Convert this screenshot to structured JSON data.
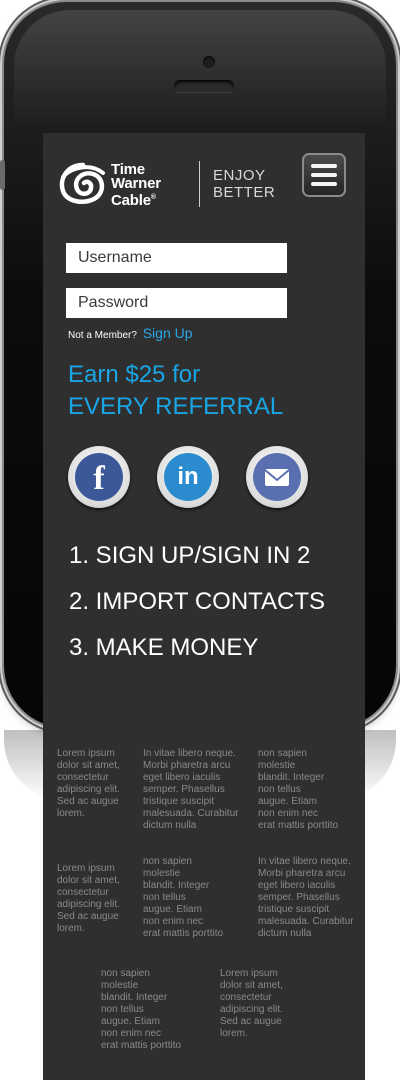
{
  "header": {
    "logo_text": "Time\nWarner\nCable",
    "tagline": "ENJOY\nBETTER"
  },
  "login": {
    "username_placeholder": "Username",
    "password_placeholder": "Password",
    "not_member": "Not a Member?",
    "signup_label": "Sign Up"
  },
  "promo": {
    "line1": "Earn $25 for",
    "line2": "EVERY REFERRAL"
  },
  "social": {
    "facebook_glyph": "f",
    "linkedin_glyph": "in",
    "colors": {
      "facebook": "#3b5998",
      "linkedin": "#2a8ccf",
      "email": "#5a6fb0"
    }
  },
  "steps": [
    "1. SIGN UP/SIGN IN 2",
    "2. IMPORT CONTACTS",
    "3. MAKE MONEY"
  ],
  "lorem": {
    "a": "Lorem ipsum\ndolor sit amet,\nconsectetur\nadipiscing elit.\nSed ac augue\nlorem.",
    "b": "In vitae libero neque.\nMorbi pharetra arcu\neget libero iaculis\nsemper. Phasellus\ntristique suscipit\nmalesuada. Curabitur\ndictum nulla",
    "c": "non sapien\nmolestie\n blandit. Integer\nnon tellus\naugue. Etiam\nnon enim nec\nerat mattis porttito"
  },
  "colors": {
    "accent": "#19a6e6",
    "screen_bg": "#2f2f2f",
    "lorem_text": "#8a8a8a"
  }
}
